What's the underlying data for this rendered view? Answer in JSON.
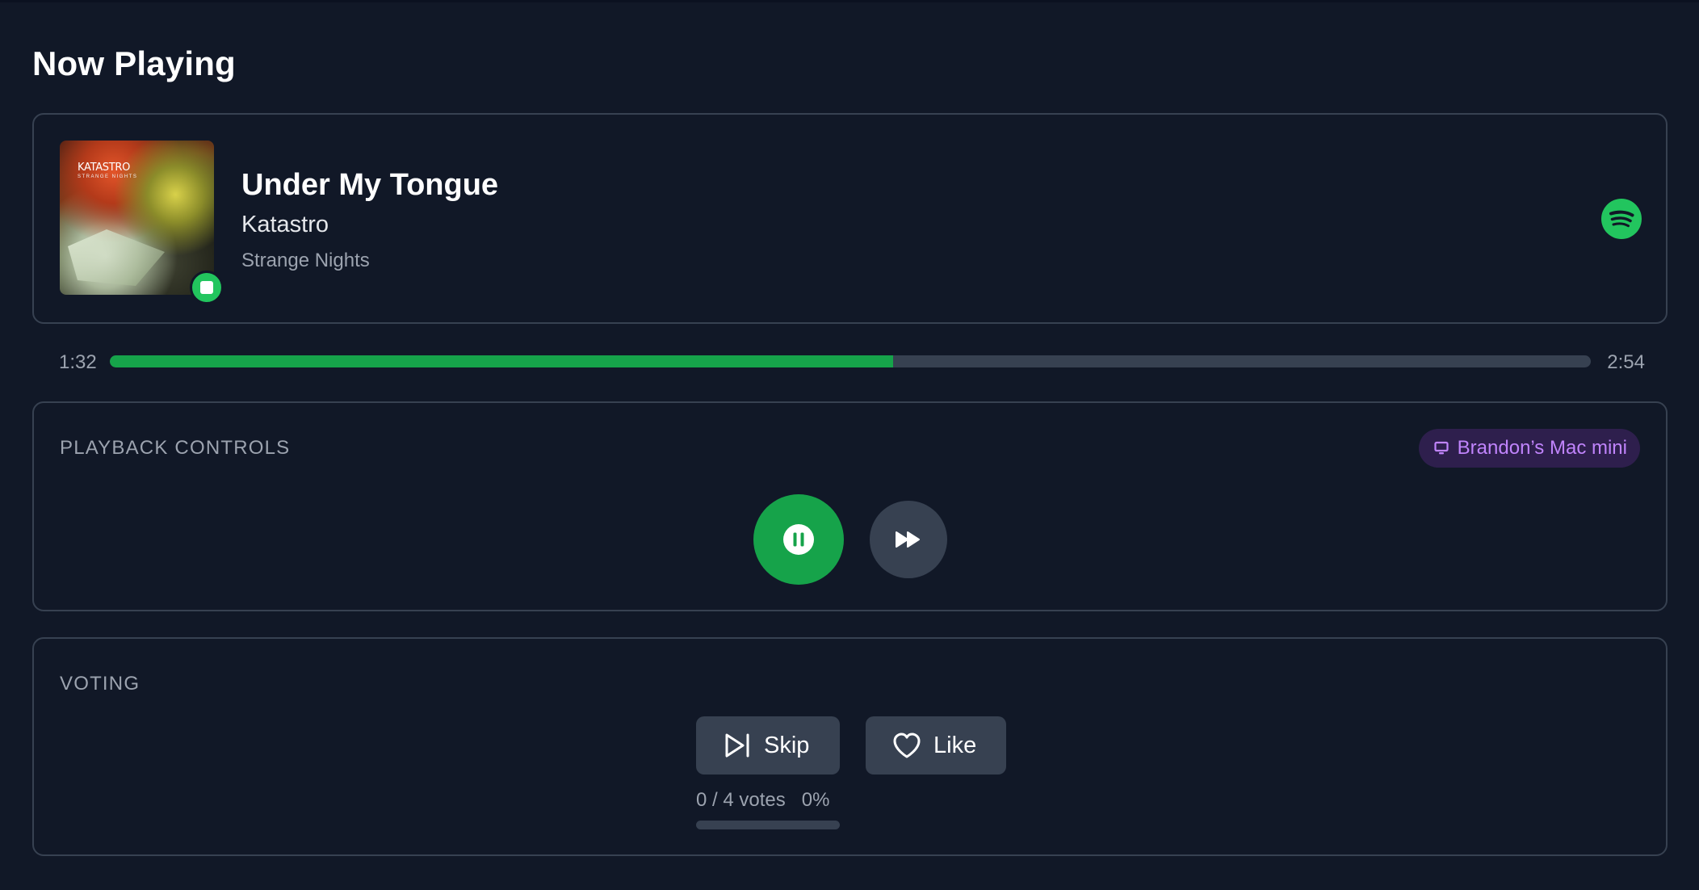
{
  "page": {
    "title": "Now Playing"
  },
  "track": {
    "title": "Under My Tongue",
    "artist": "Katastro",
    "album": "Strange Nights",
    "art_text": "KATASTRO",
    "art_subtext": "STRANGE NIGHTS",
    "service_icon": "spotify-icon",
    "status_icon": "stop-icon"
  },
  "progress": {
    "elapsed": "1:32",
    "total": "2:54",
    "fraction": 0.529
  },
  "playback": {
    "section_label": "PLAYBACK CONTROLS",
    "device_name": "Brandon’s Mac mini",
    "device_icon": "monitor-icon",
    "pause_icon": "pause-icon",
    "skip_icon": "fast-forward-icon"
  },
  "voting": {
    "section_label": "VOTING",
    "skip_label": "Skip",
    "like_label": "Like",
    "votes_text": "0 / 4 votes",
    "percent_text": "0%",
    "vote_fraction": 0
  },
  "colors": {
    "background": "#111827",
    "accent_green": "#16a34a",
    "spotify_green": "#22c55e",
    "device_purple": "#c084fc",
    "border": "#374151"
  }
}
